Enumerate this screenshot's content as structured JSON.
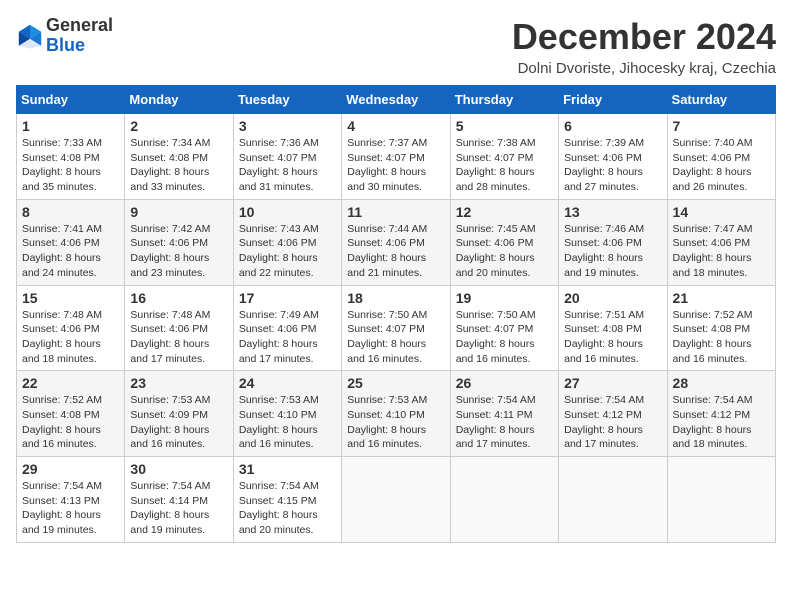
{
  "header": {
    "logo_line1": "General",
    "logo_line2": "Blue",
    "month_title": "December 2024",
    "location": "Dolni Dvoriste, Jihocesky kraj, Czechia"
  },
  "days_of_week": [
    "Sunday",
    "Monday",
    "Tuesday",
    "Wednesday",
    "Thursday",
    "Friday",
    "Saturday"
  ],
  "weeks": [
    [
      {
        "day": "1",
        "info": "Sunrise: 7:33 AM\nSunset: 4:08 PM\nDaylight: 8 hours\nand 35 minutes."
      },
      {
        "day": "2",
        "info": "Sunrise: 7:34 AM\nSunset: 4:08 PM\nDaylight: 8 hours\nand 33 minutes."
      },
      {
        "day": "3",
        "info": "Sunrise: 7:36 AM\nSunset: 4:07 PM\nDaylight: 8 hours\nand 31 minutes."
      },
      {
        "day": "4",
        "info": "Sunrise: 7:37 AM\nSunset: 4:07 PM\nDaylight: 8 hours\nand 30 minutes."
      },
      {
        "day": "5",
        "info": "Sunrise: 7:38 AM\nSunset: 4:07 PM\nDaylight: 8 hours\nand 28 minutes."
      },
      {
        "day": "6",
        "info": "Sunrise: 7:39 AM\nSunset: 4:06 PM\nDaylight: 8 hours\nand 27 minutes."
      },
      {
        "day": "7",
        "info": "Sunrise: 7:40 AM\nSunset: 4:06 PM\nDaylight: 8 hours\nand 26 minutes."
      }
    ],
    [
      {
        "day": "8",
        "info": "Sunrise: 7:41 AM\nSunset: 4:06 PM\nDaylight: 8 hours\nand 24 minutes."
      },
      {
        "day": "9",
        "info": "Sunrise: 7:42 AM\nSunset: 4:06 PM\nDaylight: 8 hours\nand 23 minutes."
      },
      {
        "day": "10",
        "info": "Sunrise: 7:43 AM\nSunset: 4:06 PM\nDaylight: 8 hours\nand 22 minutes."
      },
      {
        "day": "11",
        "info": "Sunrise: 7:44 AM\nSunset: 4:06 PM\nDaylight: 8 hours\nand 21 minutes."
      },
      {
        "day": "12",
        "info": "Sunrise: 7:45 AM\nSunset: 4:06 PM\nDaylight: 8 hours\nand 20 minutes."
      },
      {
        "day": "13",
        "info": "Sunrise: 7:46 AM\nSunset: 4:06 PM\nDaylight: 8 hours\nand 19 minutes."
      },
      {
        "day": "14",
        "info": "Sunrise: 7:47 AM\nSunset: 4:06 PM\nDaylight: 8 hours\nand 18 minutes."
      }
    ],
    [
      {
        "day": "15",
        "info": "Sunrise: 7:48 AM\nSunset: 4:06 PM\nDaylight: 8 hours\nand 18 minutes."
      },
      {
        "day": "16",
        "info": "Sunrise: 7:48 AM\nSunset: 4:06 PM\nDaylight: 8 hours\nand 17 minutes."
      },
      {
        "day": "17",
        "info": "Sunrise: 7:49 AM\nSunset: 4:06 PM\nDaylight: 8 hours\nand 17 minutes."
      },
      {
        "day": "18",
        "info": "Sunrise: 7:50 AM\nSunset: 4:07 PM\nDaylight: 8 hours\nand 16 minutes."
      },
      {
        "day": "19",
        "info": "Sunrise: 7:50 AM\nSunset: 4:07 PM\nDaylight: 8 hours\nand 16 minutes."
      },
      {
        "day": "20",
        "info": "Sunrise: 7:51 AM\nSunset: 4:08 PM\nDaylight: 8 hours\nand 16 minutes."
      },
      {
        "day": "21",
        "info": "Sunrise: 7:52 AM\nSunset: 4:08 PM\nDaylight: 8 hours\nand 16 minutes."
      }
    ],
    [
      {
        "day": "22",
        "info": "Sunrise: 7:52 AM\nSunset: 4:08 PM\nDaylight: 8 hours\nand 16 minutes."
      },
      {
        "day": "23",
        "info": "Sunrise: 7:53 AM\nSunset: 4:09 PM\nDaylight: 8 hours\nand 16 minutes."
      },
      {
        "day": "24",
        "info": "Sunrise: 7:53 AM\nSunset: 4:10 PM\nDaylight: 8 hours\nand 16 minutes."
      },
      {
        "day": "25",
        "info": "Sunrise: 7:53 AM\nSunset: 4:10 PM\nDaylight: 8 hours\nand 16 minutes."
      },
      {
        "day": "26",
        "info": "Sunrise: 7:54 AM\nSunset: 4:11 PM\nDaylight: 8 hours\nand 17 minutes."
      },
      {
        "day": "27",
        "info": "Sunrise: 7:54 AM\nSunset: 4:12 PM\nDaylight: 8 hours\nand 17 minutes."
      },
      {
        "day": "28",
        "info": "Sunrise: 7:54 AM\nSunset: 4:12 PM\nDaylight: 8 hours\nand 18 minutes."
      }
    ],
    [
      {
        "day": "29",
        "info": "Sunrise: 7:54 AM\nSunset: 4:13 PM\nDaylight: 8 hours\nand 19 minutes."
      },
      {
        "day": "30",
        "info": "Sunrise: 7:54 AM\nSunset: 4:14 PM\nDaylight: 8 hours\nand 19 minutes."
      },
      {
        "day": "31",
        "info": "Sunrise: 7:54 AM\nSunset: 4:15 PM\nDaylight: 8 hours\nand 20 minutes."
      },
      {
        "day": "",
        "info": ""
      },
      {
        "day": "",
        "info": ""
      },
      {
        "day": "",
        "info": ""
      },
      {
        "day": "",
        "info": ""
      }
    ]
  ]
}
